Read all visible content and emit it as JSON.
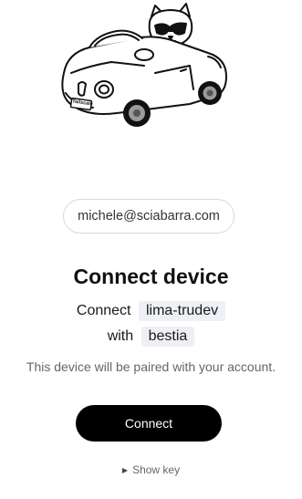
{
  "illustration": {
    "name": "car-with-dog-illustration",
    "plate": "Tailscale"
  },
  "account": {
    "email": "michele@sciabarra.com"
  },
  "heading": {
    "title": "Connect device"
  },
  "pairing": {
    "connect_word": "Connect",
    "device_name": "lima-trudev",
    "with_word": "with",
    "tailnet_name": "bestia"
  },
  "note": "This device will be paired with your account.",
  "actions": {
    "connect_label": "Connect",
    "show_key_label": "Show key",
    "show_key_icon": "triangle-right-icon"
  },
  "colors": {
    "button_bg": "#000000",
    "button_text": "#ffffff",
    "chip_bg": "#eef0f6",
    "muted_text": "#666666"
  }
}
